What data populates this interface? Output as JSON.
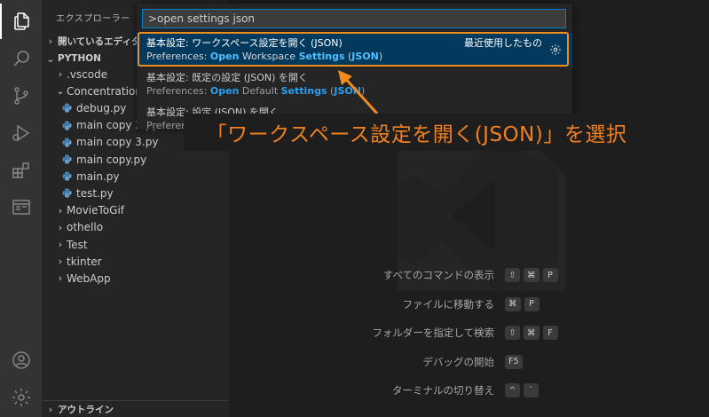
{
  "colors": {
    "accent": "#007fd4",
    "selection": "#04395e",
    "highlight_match": "#4fc1ff",
    "annotation": "#f08c1e",
    "python_icon": "#4584b6"
  },
  "activity_bar": {
    "icons": [
      "explorer-icon",
      "search-icon",
      "source-control-icon",
      "run-debug-icon",
      "extensions-icon",
      "remote-explorer-icon",
      "account-icon",
      "settings-gear-icon"
    ]
  },
  "sidebar": {
    "title": "エクスプローラー",
    "open_editors_label": "開いているエディター",
    "workspace_label": "PYTHON",
    "tree": [
      {
        "label": ".vscode",
        "type": "folder",
        "expanded": false,
        "depth": 1
      },
      {
        "label": "Concentration",
        "type": "folder",
        "expanded": true,
        "depth": 1
      },
      {
        "label": "debug.py",
        "type": "py",
        "depth": 2
      },
      {
        "label": "main copy 2.py",
        "type": "py",
        "depth": 2
      },
      {
        "label": "main copy 3.py",
        "type": "py",
        "depth": 2
      },
      {
        "label": "main copy.py",
        "type": "py",
        "depth": 2
      },
      {
        "label": "main.py",
        "type": "py",
        "depth": 2
      },
      {
        "label": "test.py",
        "type": "py",
        "depth": 2
      },
      {
        "label": "MovieToGif",
        "type": "folder",
        "expanded": false,
        "depth": 1
      },
      {
        "label": "othello",
        "type": "folder",
        "expanded": false,
        "depth": 1
      },
      {
        "label": "Test",
        "type": "folder",
        "expanded": false,
        "depth": 1
      },
      {
        "label": "tkinter",
        "type": "folder",
        "expanded": false,
        "depth": 1
      },
      {
        "label": "WebApp",
        "type": "folder",
        "expanded": false,
        "depth": 1
      }
    ],
    "outline_label": "アウトライン"
  },
  "quick_input": {
    "value": ">open settings json",
    "items": [
      {
        "label": "基本設定: ワークスペース設定を開く (JSON)",
        "detail_parts": [
          {
            "t": "Preferences: ",
            "h": false
          },
          {
            "t": "Open",
            "h": true
          },
          {
            "t": " Workspace ",
            "h": false
          },
          {
            "t": "Settings",
            "h": true
          },
          {
            "t": " (",
            "h": false
          },
          {
            "t": "JSON",
            "h": true
          },
          {
            "t": ")",
            "h": false
          }
        ],
        "hint": "最近使用したもの",
        "selected": true
      },
      {
        "label": "基本設定: 既定の設定 (JSON) を開く",
        "detail_parts": [
          {
            "t": "Preferences: ",
            "h": false
          },
          {
            "t": "Open",
            "h": true
          },
          {
            "t": " Default ",
            "h": false
          },
          {
            "t": "Settings",
            "h": true
          },
          {
            "t": " (",
            "h": false
          },
          {
            "t": "JSON",
            "h": true
          },
          {
            "t": ")",
            "h": false
          }
        ],
        "hint": "",
        "selected": false
      },
      {
        "label": "基本設定: 設定 (JSON) を開く",
        "detail_parts": [
          {
            "t": "Preferer",
            "h": false
          }
        ],
        "hint": "",
        "selected": false
      }
    ]
  },
  "annotation": {
    "text": "「ワークスペース設定を開く(JSON)」を選択"
  },
  "shortcuts": [
    {
      "label": "すべてのコマンドの表示",
      "keys": [
        "⇧",
        "⌘",
        "P"
      ]
    },
    {
      "label": "ファイルに移動する",
      "keys": [
        "⌘",
        "P"
      ]
    },
    {
      "label": "フォルダーを指定して検索",
      "keys": [
        "⇧",
        "⌘",
        "F"
      ]
    },
    {
      "label": "デバッグの開始",
      "keys": [
        "F5"
      ]
    },
    {
      "label": "ターミナルの切り替え",
      "keys": [
        "^",
        "`"
      ]
    }
  ]
}
